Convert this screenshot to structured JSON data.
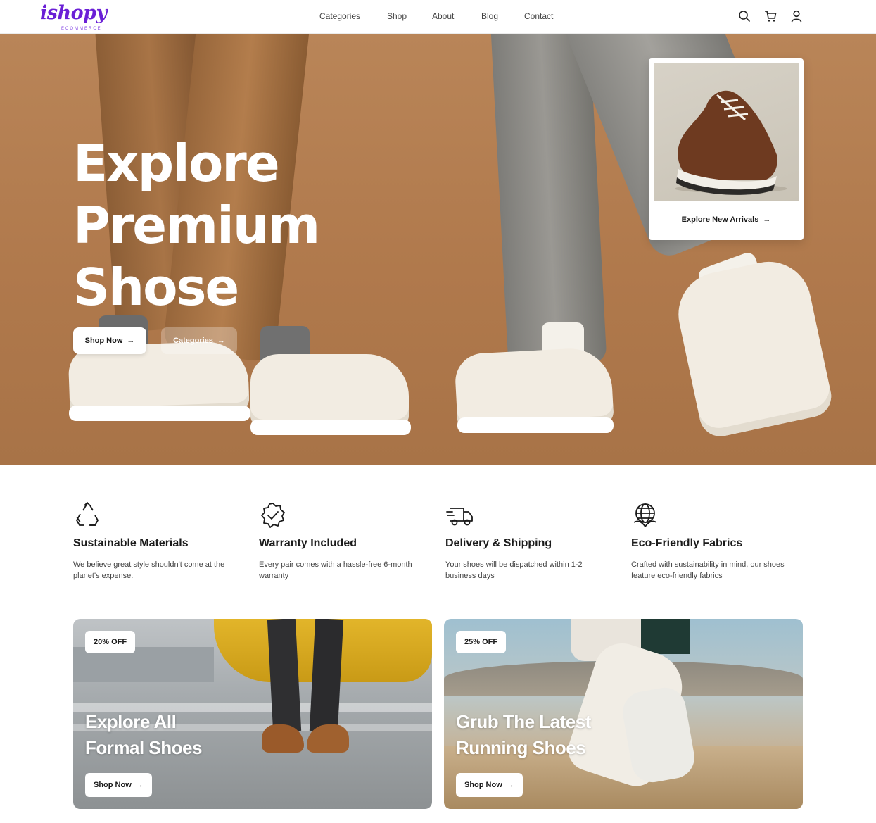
{
  "brand": {
    "name": "ishopy",
    "tagline": "ECOMMERCE"
  },
  "nav": {
    "items": [
      {
        "label": "Categories"
      },
      {
        "label": "Shop"
      },
      {
        "label": "About"
      },
      {
        "label": "Blog"
      },
      {
        "label": "Contact"
      }
    ]
  },
  "header_icons": [
    "search-icon",
    "cart-icon",
    "user-icon"
  ],
  "hero": {
    "title_lines": [
      "Explore",
      "Premium",
      "Shose"
    ],
    "primary_button": "Shop Now",
    "secondary_button": "Categories",
    "arrivals_card": {
      "label": "Explore New Arrivals"
    }
  },
  "features": [
    {
      "icon": "recycle-icon",
      "title": "Sustainable Materials",
      "desc": "We believe great style shouldn't come at the planet's expense."
    },
    {
      "icon": "badge-check-icon",
      "title": "Warranty Included",
      "desc": "Every pair comes with a hassle-free 6-month warranty"
    },
    {
      "icon": "truck-icon",
      "title": "Delivery & Shipping",
      "desc": "Your shoes will be dispatched within 1-2 business days"
    },
    {
      "icon": "globe-leaf-icon",
      "title": "Eco-Friendly Fabrics",
      "desc": "Crafted with sustainability in mind, our shoes feature eco-friendly fabrics"
    }
  ],
  "promos": [
    {
      "badge": "20% OFF",
      "title_lines": [
        "Explore All",
        "Formal Shoes"
      ],
      "button": "Shop Now"
    },
    {
      "badge": "25% OFF",
      "title_lines": [
        "Grub The Latest",
        "Running Shoes"
      ],
      "button": "Shop Now"
    }
  ],
  "colors": {
    "brand": "#6a1fd6",
    "hero_bg": "#b0794c",
    "text": "#1a1a1a"
  }
}
